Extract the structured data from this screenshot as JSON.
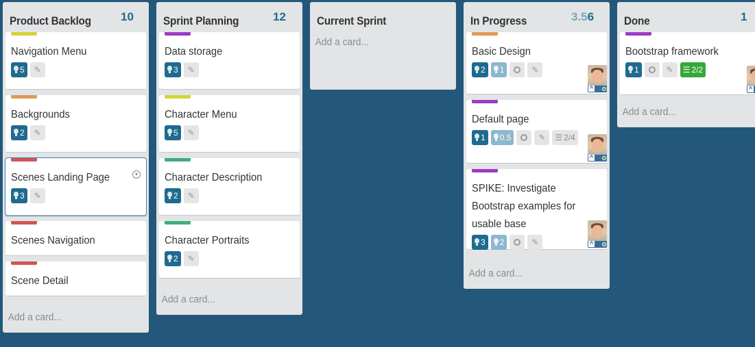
{
  "colors": {
    "background": "#23587a",
    "label_yellow": "#d6d435",
    "label_orange": "#e09a55",
    "label_red": "#d05555",
    "label_green": "#3fae7a",
    "label_purple": "#9b3bc8"
  },
  "add_card_label": "Add a card...",
  "lists": [
    {
      "title": "Product Backlog",
      "count": "10",
      "cards": [
        {
          "title": "Navigation Menu",
          "label": "yellow",
          "points": "5"
        },
        {
          "title": "Backgrounds",
          "label": "orange",
          "points": "2"
        },
        {
          "title": "Scenes Landing Page",
          "label": "red",
          "points": "3"
        },
        {
          "title": "Scenes Navigation",
          "label": "red"
        },
        {
          "title": "Scene Detail",
          "label": "red"
        }
      ]
    },
    {
      "title": "Sprint Planning",
      "count": "12",
      "cards": [
        {
          "title": "Data storage",
          "label": "purple",
          "points": "3"
        },
        {
          "title": "Character Menu",
          "label": "yellow",
          "points": "5"
        },
        {
          "title": "Character Description",
          "label": "green",
          "points": "2"
        },
        {
          "title": "Character Portraits",
          "label": "green",
          "points": "2"
        }
      ]
    },
    {
      "title": "Current Sprint",
      "cards": []
    },
    {
      "title": "In Progress",
      "count_light": "3.5",
      "count": "6",
      "cards": [
        {
          "title": "Basic Design",
          "label": "orange",
          "points": "2",
          "spent": "1"
        },
        {
          "title": "Default page",
          "label": "purple",
          "points": "1",
          "spent": "0.5",
          "checklist": "2/4"
        },
        {
          "title": "SPIKE: Investigate Bootstrap examples for usable base",
          "label": "purple",
          "points": "3",
          "spent": "2"
        }
      ]
    },
    {
      "title": "Done",
      "count": "1",
      "cards": [
        {
          "title": "Bootstrap framework",
          "label": "purple",
          "points": "1",
          "checklist": "2/2"
        }
      ]
    }
  ]
}
